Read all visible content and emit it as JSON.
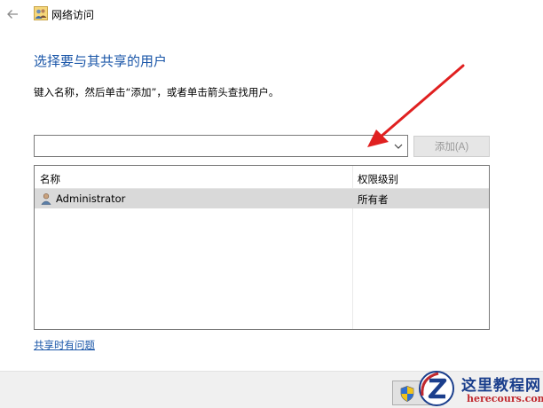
{
  "window": {
    "title": "网络访问",
    "back_icon": "back-arrow-icon",
    "title_icon": "network-users-icon"
  },
  "heading": "选择要与其共享的用户",
  "instruction": "键入名称，然后单击“添加”，或者单击箭头查找用户。",
  "user_input": {
    "value": "",
    "placeholder": ""
  },
  "add_button": "添加(A)",
  "table": {
    "columns": [
      "名称",
      "权限级别"
    ],
    "rows": [
      {
        "name": "Administrator",
        "permission": "所有者"
      }
    ]
  },
  "help_link": "共享时有问题",
  "watermark": {
    "title": "这里教程网",
    "url": "herecours.com"
  },
  "colors": {
    "heading": "#1a56a8",
    "link": "#1a56a8",
    "annotation_arrow": "#e02020",
    "selected_row": "#d9d9d9"
  }
}
